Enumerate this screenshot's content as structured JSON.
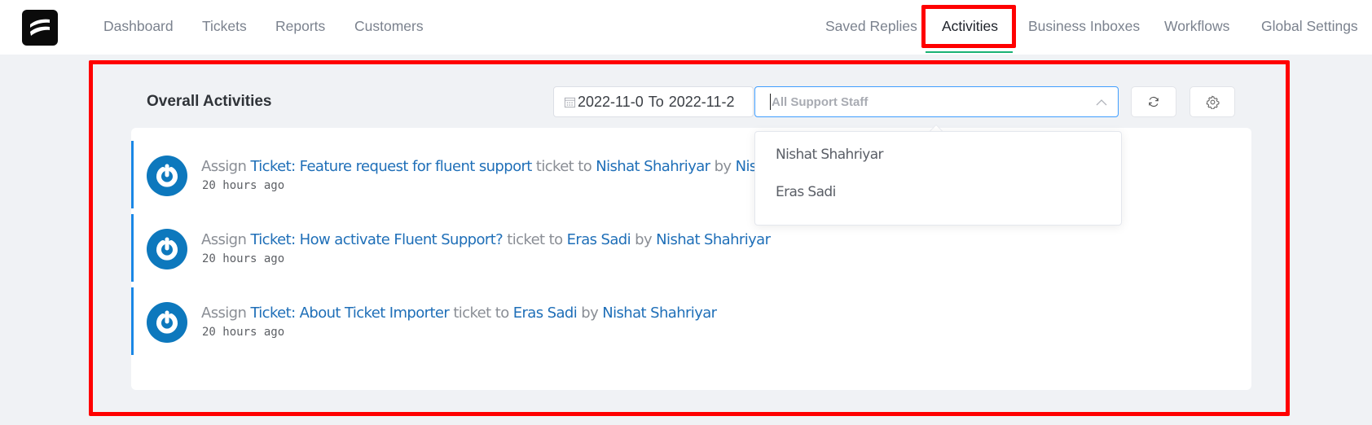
{
  "nav": {
    "left": [
      {
        "label": "Dashboard"
      },
      {
        "label": "Tickets"
      },
      {
        "label": "Reports"
      },
      {
        "label": "Customers"
      }
    ],
    "right": [
      {
        "label": "Saved Replies"
      },
      {
        "label": "Activities",
        "active": true
      },
      {
        "label": "Business Inboxes"
      },
      {
        "label": "Workflows"
      },
      {
        "label": "Global Settings"
      }
    ],
    "active_color": "#19b274"
  },
  "main": {
    "title": "Overall Activities",
    "date_range": {
      "start": "2022-11-0",
      "separator": "To",
      "end": "2022-11-2"
    },
    "staff_filter": {
      "placeholder": "All Support Staff",
      "options": [
        "Nishat Shahriyar",
        "Eras Sadi"
      ]
    },
    "buttons": {
      "refresh_icon": "refresh-icon",
      "settings_icon": "gear-icon"
    },
    "activities": [
      {
        "action": "Assign",
        "ticket": "Ticket: Feature request for fluent support",
        "mid": "ticket to",
        "assignee": "Nishat Shahriyar",
        "by": "by",
        "actor": "Nishat Shahriyar",
        "time": "20 hours ago"
      },
      {
        "action": "Assign",
        "ticket": "Ticket: How activate Fluent Support?",
        "mid": "ticket to",
        "assignee": "Eras Sadi",
        "by": "by",
        "actor": "Nishat Shahriyar",
        "time": "20 hours ago"
      },
      {
        "action": "Assign",
        "ticket": "Ticket: About Ticket Importer",
        "mid": "ticket to",
        "assignee": "Eras Sadi",
        "by": "by",
        "actor": "Nishat Shahriyar",
        "time": "20 hours ago"
      }
    ]
  },
  "colors": {
    "highlight": "#ff0000",
    "link": "#1f6fb8",
    "accent_border": "#1a87e6",
    "avatar": "#0d78bd"
  }
}
